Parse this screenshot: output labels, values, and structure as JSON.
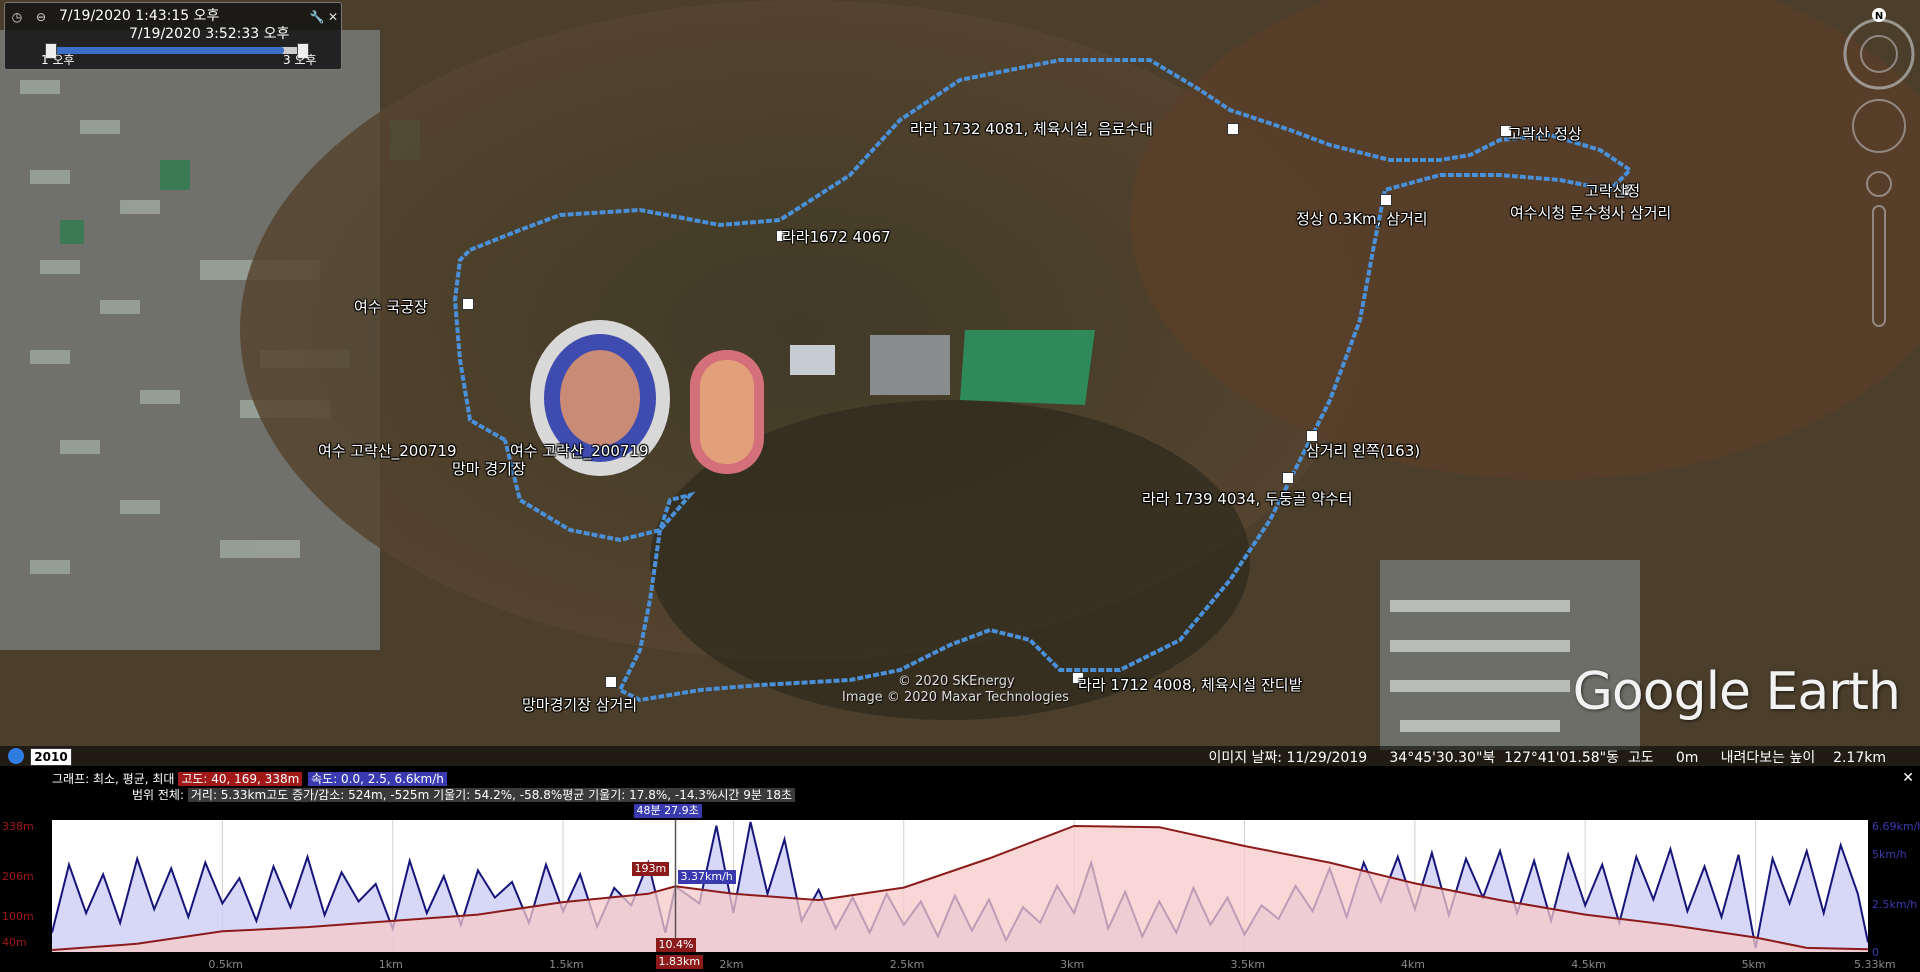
{
  "time_slider": {
    "start_datetime": "7/19/2020   1:43:15 오후",
    "end_datetime": "7/19/2020   3:52:33 오후",
    "start_label": "1 오후",
    "end_label": "3 오후",
    "fill_fraction": 0.92
  },
  "map": {
    "placemarks": [
      {
        "label": "라라 1732 4081, 체육시설, 음료수대"
      },
      {
        "label": "고락산 정상"
      },
      {
        "label": "고락산정"
      },
      {
        "label": "여수시청 문수청사 삼거리"
      },
      {
        "label": "정상 0.3Km, 삼거리"
      },
      {
        "label": "라라1672 4067"
      },
      {
        "label": "여수 국궁장"
      },
      {
        "label": "여수 고락산_200719"
      },
      {
        "label": "여수 고락산_200719"
      },
      {
        "label": "망마 경기장"
      },
      {
        "label": "삼거리 왼쪽(163)"
      },
      {
        "label": "라라 1739 4034, 두둥골 약수터"
      },
      {
        "label": "망마경기장 삼거리"
      },
      {
        "label": "라라 1712 4008, 체육시설 잔디밭"
      }
    ],
    "copyright": [
      "© 2020 SKEnergy",
      "Image © 2020 Maxar Technologies"
    ],
    "brand": "Google Earth",
    "year": "2010",
    "status": "이미지 날짜: 11/29/2019     34°45'30.30\"북  127°41'01.58\"동  고도     0m     내려다보는 높이    2.17km"
  },
  "elevation_profile": {
    "graph_label": "그래프: 최소, 평균, 최대",
    "elevation_stats": "고도: 40, 169, 338m",
    "speed_stats": "속도: 0.0, 2.5, 6.6km/h",
    "range_label": "범위 전체:",
    "range_stats": "거리: 5.33km고도 증가/감소: 524m, -525m 기울기: 54.2%, -58.8%평균 기울기: 17.8%, -14.3%시간 9분 18초",
    "cursor_time": "48분 27.9초",
    "cursor_elev": "193m",
    "cursor_speed": "3.37km/h",
    "cursor_grade": "10.4%",
    "cursor_dist": "1.83km",
    "y_left": [
      "338m",
      "206m",
      "100m",
      "40m"
    ],
    "y_right": [
      "6.69km/h",
      "5km/h",
      "2.5km/h",
      "0"
    ],
    "x_ticks": [
      "0.5km",
      "1km",
      "1.5km",
      "2km",
      "2.5km",
      "3km",
      "3.5km",
      "4km",
      "4.5km",
      "5km",
      "5.33km"
    ],
    "cursor_distance_km": 1.83,
    "elevation_curve": [
      [
        0,
        40
      ],
      [
        0.25,
        55
      ],
      [
        0.5,
        85
      ],
      [
        0.75,
        95
      ],
      [
        1.0,
        110
      ],
      [
        1.25,
        125
      ],
      [
        1.5,
        155
      ],
      [
        1.75,
        175
      ],
      [
        1.83,
        193
      ],
      [
        2.0,
        175
      ],
      [
        2.25,
        160
      ],
      [
        2.5,
        190
      ],
      [
        2.75,
        260
      ],
      [
        3.0,
        338
      ],
      [
        3.25,
        335
      ],
      [
        3.5,
        290
      ],
      [
        3.75,
        250
      ],
      [
        4.0,
        200
      ],
      [
        4.25,
        160
      ],
      [
        4.5,
        125
      ],
      [
        4.75,
        100
      ],
      [
        5.0,
        70
      ],
      [
        5.15,
        45
      ],
      [
        5.33,
        42
      ]
    ],
    "speed_curve": [
      [
        0,
        1.0
      ],
      [
        0.05,
        4.5
      ],
      [
        0.1,
        2.0
      ],
      [
        0.15,
        4.0
      ],
      [
        0.2,
        1.5
      ],
      [
        0.25,
        4.8
      ],
      [
        0.3,
        2.2
      ],
      [
        0.35,
        4.3
      ],
      [
        0.4,
        1.8
      ],
      [
        0.45,
        4.6
      ],
      [
        0.5,
        2.5
      ],
      [
        0.55,
        3.8
      ],
      [
        0.6,
        1.6
      ],
      [
        0.65,
        4.4
      ],
      [
        0.7,
        2.3
      ],
      [
        0.75,
        4.9
      ],
      [
        0.8,
        1.9
      ],
      [
        0.85,
        4.1
      ],
      [
        0.9,
        2.6
      ],
      [
        0.95,
        3.5
      ],
      [
        1.0,
        1.2
      ],
      [
        1.05,
        4.7
      ],
      [
        1.1,
        2.0
      ],
      [
        1.15,
        3.9
      ],
      [
        1.2,
        1.4
      ],
      [
        1.25,
        4.2
      ],
      [
        1.3,
        2.8
      ],
      [
        1.35,
        3.6
      ],
      [
        1.4,
        1.5
      ],
      [
        1.45,
        4.5
      ],
      [
        1.5,
        2.1
      ],
      [
        1.55,
        4.0
      ],
      [
        1.6,
        1.3
      ],
      [
        1.65,
        3.3
      ],
      [
        1.7,
        2.4
      ],
      [
        1.75,
        4.6
      ],
      [
        1.8,
        1.0
      ],
      [
        1.83,
        3.37
      ],
      [
        1.9,
        2.5
      ],
      [
        1.95,
        6.5
      ],
      [
        2.0,
        2.0
      ],
      [
        2.05,
        6.69
      ],
      [
        2.1,
        3.0
      ],
      [
        2.15,
        5.8
      ],
      [
        2.2,
        1.6
      ],
      [
        2.25,
        3.2
      ],
      [
        2.3,
        1.2
      ],
      [
        2.35,
        2.8
      ],
      [
        2.4,
        1.0
      ],
      [
        2.45,
        3.0
      ],
      [
        2.5,
        1.4
      ],
      [
        2.55,
        2.6
      ],
      [
        2.6,
        0.8
      ],
      [
        2.65,
        2.9
      ],
      [
        2.7,
        1.1
      ],
      [
        2.75,
        2.7
      ],
      [
        2.8,
        0.6
      ],
      [
        2.85,
        2.3
      ],
      [
        2.9,
        1.5
      ],
      [
        2.95,
        3.4
      ],
      [
        3.0,
        2.0
      ],
      [
        3.05,
        4.6
      ],
      [
        3.1,
        1.2
      ],
      [
        3.15,
        3.1
      ],
      [
        3.2,
        0.8
      ],
      [
        3.25,
        2.6
      ],
      [
        3.3,
        1.0
      ],
      [
        3.35,
        3.3
      ],
      [
        3.4,
        1.4
      ],
      [
        3.45,
        2.8
      ],
      [
        3.5,
        0.9
      ],
      [
        3.55,
        2.4
      ],
      [
        3.6,
        1.7
      ],
      [
        3.65,
        3.4
      ],
      [
        3.7,
        2.1
      ],
      [
        3.75,
        4.3
      ],
      [
        3.8,
        1.8
      ],
      [
        3.85,
        4.6
      ],
      [
        3.9,
        2.6
      ],
      [
        3.95,
        4.9
      ],
      [
        4.0,
        2.2
      ],
      [
        4.05,
        5.1
      ],
      [
        4.1,
        1.9
      ],
      [
        4.15,
        4.8
      ],
      [
        4.2,
        2.8
      ],
      [
        4.25,
        5.2
      ],
      [
        4.3,
        2.0
      ],
      [
        4.35,
        4.7
      ],
      [
        4.4,
        1.6
      ],
      [
        4.45,
        5.0
      ],
      [
        4.5,
        2.4
      ],
      [
        4.55,
        4.5
      ],
      [
        4.6,
        1.5
      ],
      [
        4.65,
        4.9
      ],
      [
        4.7,
        2.7
      ],
      [
        4.75,
        5.3
      ],
      [
        4.8,
        2.1
      ],
      [
        4.85,
        4.4
      ],
      [
        4.9,
        1.8
      ],
      [
        4.95,
        5.0
      ],
      [
        5.0,
        0.2
      ],
      [
        5.05,
        4.8
      ],
      [
        5.1,
        2.5
      ],
      [
        5.15,
        5.2
      ],
      [
        5.2,
        2.0
      ],
      [
        5.25,
        5.5
      ],
      [
        5.3,
        3.0
      ],
      [
        5.33,
        0.5
      ]
    ]
  },
  "colors": {
    "elevation_line": "#8b1a1a",
    "elevation_fill": "#f7c9c9",
    "speed_line": "#15157a",
    "speed_fill": "#c9c9f5",
    "track": "#4a90d9"
  }
}
